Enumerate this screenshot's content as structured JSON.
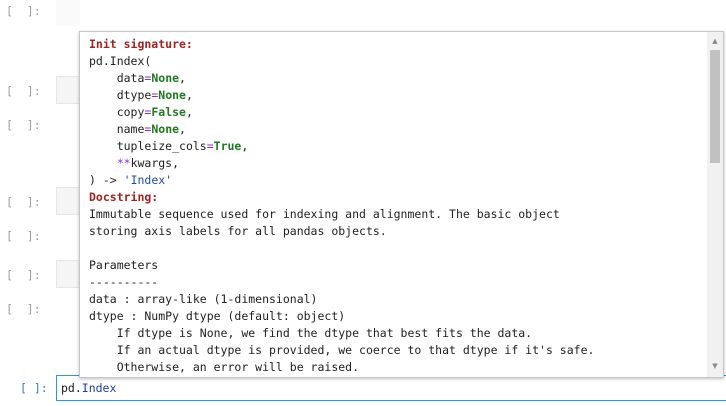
{
  "prompts": {
    "empty": "[  ]:",
    "active": "[ ]:"
  },
  "active_cell": {
    "code_prefix": "pd.",
    "code_name": "Index"
  },
  "tooltip": {
    "init_signature_header": "Init signature:",
    "call": "pd.Index(",
    "params": [
      {
        "name": "data",
        "value": "None"
      },
      {
        "name": "dtype",
        "value": "None"
      },
      {
        "name": "copy",
        "value": "False"
      },
      {
        "name": "name",
        "value": "None"
      },
      {
        "name": "tupleize_cols",
        "value": "True"
      }
    ],
    "kwargs": "kwargs,",
    "return_arrow": ") ->",
    "return_type": "'Index'",
    "docstring_header": "Docstring:",
    "doc_lines": [
      "Immutable sequence used for indexing and alignment. The basic object",
      "storing axis labels for all pandas objects.",
      "",
      "Parameters",
      "----------",
      "data : array-like (1-dimensional)",
      "dtype : NumPy dtype (default: object)",
      "    If dtype is None, we find the dtype that best fits the data.",
      "    If an actual dtype is provided, we coerce to that dtype if it's safe.",
      "    Otherwise, an error will be raised."
    ]
  },
  "scrollbar": {
    "up_icon": "▲",
    "down_icon": "▼"
  }
}
